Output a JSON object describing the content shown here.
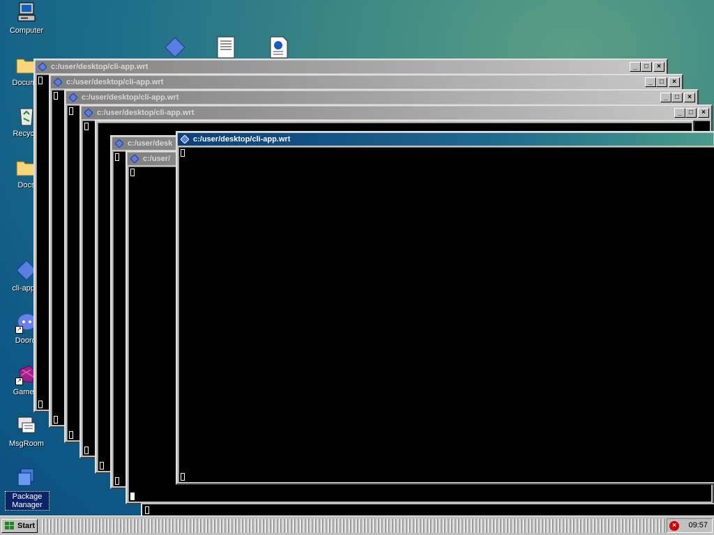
{
  "desktop": {
    "icons": [
      {
        "label": "Computer",
        "icon": "computer-icon"
      },
      {
        "label": "Docume",
        "icon": "folder-documents-icon"
      },
      {
        "label": "Recycle",
        "icon": "recycle-bin-icon"
      },
      {
        "label": "Docs",
        "icon": "folder-icon"
      },
      {
        "label": "cli-app.v",
        "icon": "diamond-app-icon"
      },
      {
        "label": "Doordi",
        "icon": "chat-app-icon"
      },
      {
        "label": "Gamein",
        "icon": "game-icon"
      },
      {
        "label": "MsgRoom",
        "icon": "msgroom-icon"
      },
      {
        "label": "Package Manager",
        "icon": "package-manager-icon"
      }
    ],
    "top_icons": [
      "diamond-app-icon",
      "text-document-icon",
      "web-document-icon"
    ]
  },
  "windows": [
    {
      "title": "c:/user/desktop/cli-app.wrt",
      "active": false
    },
    {
      "title": "c:/user/desktop/cli-app.wrt",
      "active": false
    },
    {
      "title": "c:/user/desktop/cli-app.wrt",
      "active": false
    },
    {
      "title": "c:/user/desktop/cli-app.wrt",
      "active": false
    },
    {
      "title": "c:/user/desk",
      "active": false
    },
    {
      "title": "c:/user/",
      "active": false
    },
    {
      "title": "c:/user/desktop/cli-app.wrt",
      "active": true
    }
  ],
  "title_buttons": {
    "minimize": "_",
    "maximize": "□",
    "close": "×"
  },
  "taskbar": {
    "start_label": "Start",
    "clock": "09:57",
    "tray_icon": "error-icon"
  },
  "colors": {
    "active_title": "#0b3f7a",
    "inactive_title": "#808080",
    "terminal_bg": "#000000"
  }
}
